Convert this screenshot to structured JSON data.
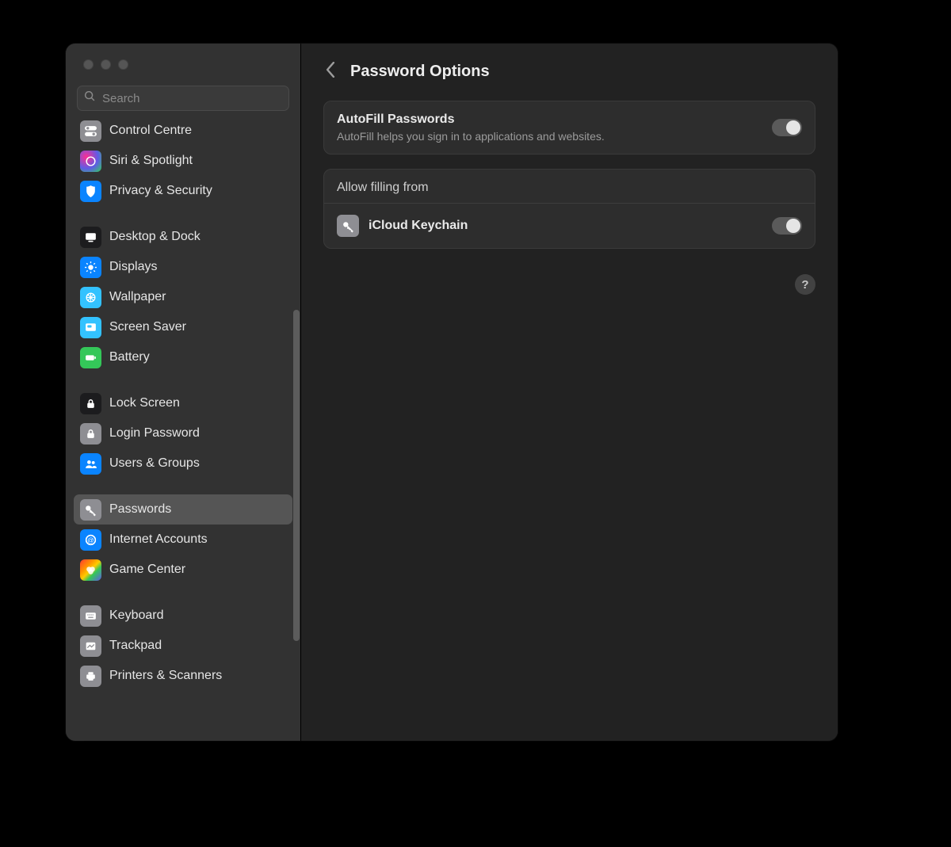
{
  "search": {
    "placeholder": "Search"
  },
  "sidebar": {
    "groups": [
      {
        "items": [
          {
            "label": "Control Centre",
            "name": "sidebar-item-control-centre"
          },
          {
            "label": "Siri & Spotlight",
            "name": "sidebar-item-siri-spotlight"
          },
          {
            "label": "Privacy & Security",
            "name": "sidebar-item-privacy-security"
          }
        ]
      },
      {
        "items": [
          {
            "label": "Desktop & Dock",
            "name": "sidebar-item-desktop-dock"
          },
          {
            "label": "Displays",
            "name": "sidebar-item-displays"
          },
          {
            "label": "Wallpaper",
            "name": "sidebar-item-wallpaper"
          },
          {
            "label": "Screen Saver",
            "name": "sidebar-item-screen-saver"
          },
          {
            "label": "Battery",
            "name": "sidebar-item-battery"
          }
        ]
      },
      {
        "items": [
          {
            "label": "Lock Screen",
            "name": "sidebar-item-lock-screen"
          },
          {
            "label": "Login Password",
            "name": "sidebar-item-login-password"
          },
          {
            "label": "Users & Groups",
            "name": "sidebar-item-users-groups"
          }
        ]
      },
      {
        "items": [
          {
            "label": "Passwords",
            "name": "sidebar-item-passwords",
            "selected": true
          },
          {
            "label": "Internet Accounts",
            "name": "sidebar-item-internet-accounts"
          },
          {
            "label": "Game Center",
            "name": "sidebar-item-game-center"
          }
        ]
      },
      {
        "items": [
          {
            "label": "Keyboard",
            "name": "sidebar-item-keyboard"
          },
          {
            "label": "Trackpad",
            "name": "sidebar-item-trackpad"
          },
          {
            "label": "Printers & Scanners",
            "name": "sidebar-item-printers-scanners"
          }
        ]
      }
    ]
  },
  "header": {
    "title": "Password Options"
  },
  "autofill": {
    "title": "AutoFill Passwords",
    "subtitle": "AutoFill helps you sign in to applications and websites.",
    "enabled": false
  },
  "allowFilling": {
    "sectionTitle": "Allow filling from",
    "items": [
      {
        "label": "iCloud Keychain",
        "enabled": false
      }
    ]
  },
  "help": {
    "label": "?"
  }
}
